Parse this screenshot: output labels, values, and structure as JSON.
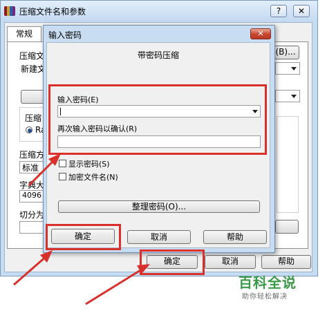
{
  "back_window": {
    "title": "压缩文件名和参数",
    "help_btn": "?",
    "close_btn": "✕",
    "tab_general": "常规",
    "archive_label": "压缩文",
    "archive_value": "新建文",
    "browse_btn": "(B)...",
    "update_label": "压缩",
    "format_ra": "Ra",
    "method_label": "压缩方",
    "method_value": "标准",
    "dict_label": "字典大",
    "dict_value": "4096",
    "split_label": "切分为",
    "ok_btn": "确定",
    "cancel_btn": "取消",
    "help_bottom_btn": "帮助"
  },
  "dialog": {
    "title": "输入密码",
    "close_btn": "✕",
    "heading": "带密码压缩",
    "enter_password_label": "输入密码(E)",
    "enter_password_value": "",
    "reenter_label": "再次输入密码以确认(R)",
    "reenter_value": "",
    "show_password_label": "显示密码(S)",
    "encrypt_names_label": "加密文件名(N)",
    "organize_btn": "整理密码(O)...",
    "ok_btn": "确定",
    "cancel_btn": "取消",
    "help_btn": "帮助"
  },
  "annotation": {
    "color": "#d9302b"
  },
  "watermark": {
    "title": "百科全说",
    "subtitle": "助你轻松解决"
  }
}
